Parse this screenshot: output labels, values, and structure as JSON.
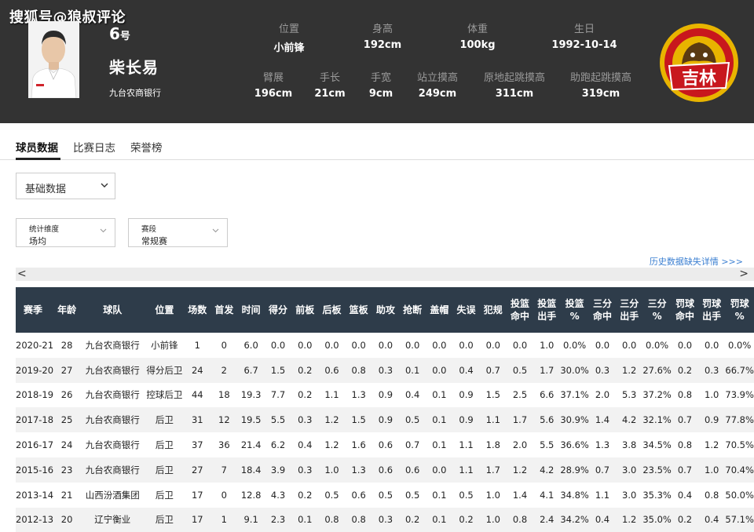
{
  "watermark": "搜狐号@狼叔评论",
  "player": {
    "number": "6",
    "number_suffix": "号",
    "name": "柴长易",
    "team": "九台农商银行"
  },
  "stats_top": [
    {
      "label": "位置",
      "value": "小前锋"
    },
    {
      "label": "身高",
      "value": "192cm"
    },
    {
      "label": "体重",
      "value": "100kg"
    },
    {
      "label": "生日",
      "value": "1992-10-14"
    }
  ],
  "stats_bottom": [
    {
      "label": "臂展",
      "value": "196cm"
    },
    {
      "label": "手长",
      "value": "21cm"
    },
    {
      "label": "手宽",
      "value": "9cm"
    },
    {
      "label": "站立摸高",
      "value": "249cm"
    },
    {
      "label": "原地起跳摸高",
      "value": "311cm"
    },
    {
      "label": "助跑起跳摸高",
      "value": "319cm"
    }
  ],
  "logo_text": "吉林",
  "tabs": [
    "球员数据",
    "比赛日志",
    "荣誉榜"
  ],
  "main_select": "基础数据",
  "filters": [
    {
      "label": "统计维度",
      "value": "场均"
    },
    {
      "label": "赛段",
      "value": "常规赛"
    }
  ],
  "history_link": "历史数据缺失详情 >>>",
  "scroll": {
    "left": "<",
    "right": ">"
  },
  "table": {
    "headers": [
      "赛季",
      "年龄",
      "球队",
      "位置",
      "场数",
      "首发",
      "时间",
      "得分",
      "前板",
      "后板",
      "篮板",
      "助攻",
      "抢断",
      "盖帽",
      "失误",
      "犯规",
      "投篮\n命中",
      "投篮\n出手",
      "投篮\n%",
      "三分\n命中",
      "三分\n出手",
      "三分\n%",
      "罚球\n命中",
      "罚球\n出手",
      "罚球\n%"
    ],
    "rows": [
      [
        "2020-21",
        "28",
        "九台农商银行",
        "小前锋",
        "1",
        "0",
        "6.0",
        "0.0",
        "0.0",
        "0.0",
        "0.0",
        "0.0",
        "0.0",
        "0.0",
        "0.0",
        "0.0",
        "0.0",
        "1.0",
        "0.0%",
        "0.0",
        "0.0",
        "0.0%",
        "0.0",
        "0.0",
        "0.0%"
      ],
      [
        "2019-20",
        "27",
        "九台农商银行",
        "得分后卫",
        "24",
        "2",
        "6.7",
        "1.5",
        "0.2",
        "0.6",
        "0.8",
        "0.3",
        "0.1",
        "0.0",
        "0.4",
        "0.7",
        "0.5",
        "1.7",
        "30.0%",
        "0.3",
        "1.2",
        "27.6%",
        "0.2",
        "0.3",
        "66.7%"
      ],
      [
        "2018-19",
        "26",
        "九台农商银行",
        "控球后卫",
        "44",
        "18",
        "19.3",
        "7.7",
        "0.2",
        "1.1",
        "1.3",
        "0.9",
        "0.4",
        "0.1",
        "0.9",
        "1.5",
        "2.5",
        "6.6",
        "37.1%",
        "2.0",
        "5.3",
        "37.2%",
        "0.8",
        "1.0",
        "73.9%"
      ],
      [
        "2017-18",
        "25",
        "九台农商银行",
        "后卫",
        "31",
        "12",
        "19.5",
        "5.5",
        "0.3",
        "1.2",
        "1.5",
        "0.9",
        "0.5",
        "0.1",
        "0.9",
        "1.1",
        "1.7",
        "5.6",
        "30.9%",
        "1.4",
        "4.2",
        "32.1%",
        "0.7",
        "0.9",
        "77.8%"
      ],
      [
        "2016-17",
        "24",
        "九台农商银行",
        "后卫",
        "37",
        "36",
        "21.4",
        "6.2",
        "0.4",
        "1.2",
        "1.6",
        "0.6",
        "0.7",
        "0.1",
        "1.1",
        "1.8",
        "2.0",
        "5.5",
        "36.6%",
        "1.3",
        "3.8",
        "34.5%",
        "0.8",
        "1.2",
        "70.5%"
      ],
      [
        "2015-16",
        "23",
        "九台农商银行",
        "后卫",
        "27",
        "7",
        "18.4",
        "3.9",
        "0.3",
        "1.0",
        "1.3",
        "0.6",
        "0.6",
        "0.0",
        "1.1",
        "1.7",
        "1.2",
        "4.2",
        "28.9%",
        "0.7",
        "3.0",
        "23.5%",
        "0.7",
        "1.0",
        "70.4%"
      ],
      [
        "2013-14",
        "21",
        "山西汾酒集团",
        "后卫",
        "17",
        "0",
        "12.8",
        "4.3",
        "0.2",
        "0.5",
        "0.6",
        "0.5",
        "0.5",
        "0.1",
        "0.5",
        "1.0",
        "1.4",
        "4.1",
        "34.8%",
        "1.1",
        "3.0",
        "35.3%",
        "0.4",
        "0.8",
        "50.0%"
      ],
      [
        "2012-13",
        "20",
        "辽宁衡业",
        "后卫",
        "17",
        "1",
        "9.1",
        "2.3",
        "0.1",
        "0.8",
        "0.8",
        "0.3",
        "0.2",
        "0.1",
        "0.2",
        "1.0",
        "0.8",
        "2.4",
        "34.2%",
        "0.4",
        "1.2",
        "35.0%",
        "0.2",
        "0.4",
        "57.1%"
      ]
    ]
  },
  "colors": {
    "header_bg": "#333333",
    "table_header_bg": "#2e3c4a",
    "link": "#3b7fd1",
    "logo_red": "#c8171d",
    "logo_gold": "#e8b400"
  }
}
